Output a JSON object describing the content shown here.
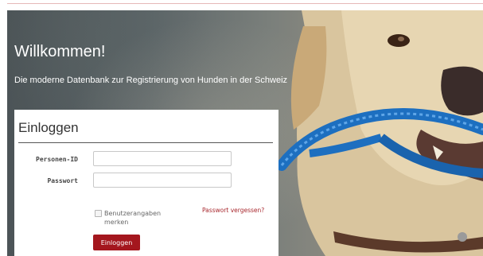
{
  "hero": {
    "title": "Willkommen!",
    "subtitle": "Die moderne Datenbank zur Registrierung von Hunden in der Schweiz"
  },
  "login": {
    "heading": "Einloggen",
    "person_id_label": "Personen-ID",
    "person_id_value": "",
    "password_label": "Passwort",
    "password_value": "",
    "remember_label": "Benutzerangaben merken",
    "forgot_password": "Passwort vergessen?",
    "submit_label": "Einloggen"
  },
  "colors": {
    "brand_red": "#a4171e",
    "link_red": "#a8282e",
    "leash_blue": "#1d6fc0"
  }
}
